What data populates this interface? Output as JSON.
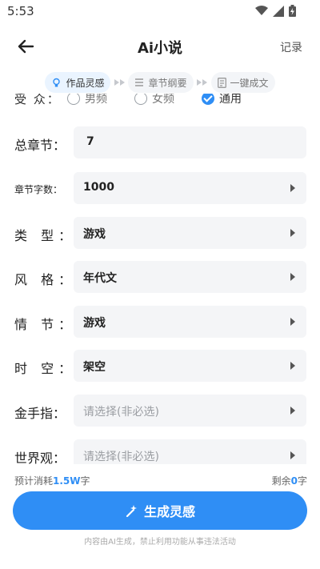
{
  "status": {
    "time": "5:53"
  },
  "header": {
    "title": "Ai小说",
    "record": "记录"
  },
  "steps": [
    {
      "label": "作品灵感",
      "active": true
    },
    {
      "label": "章节纲要",
      "active": false
    },
    {
      "label": "一键成文",
      "active": false
    }
  ],
  "form": {
    "audience": {
      "label": "受 众：",
      "options": [
        "男频",
        "女频",
        "通用"
      ],
      "selected": "通用"
    },
    "fields": [
      {
        "label": "总章节：",
        "value": "7",
        "placeholder": "",
        "dropdown": false
      },
      {
        "label": "章节字数：",
        "value": "1000",
        "placeholder": "",
        "dropdown": true
      },
      {
        "label": "类 型：",
        "value": "游戏",
        "placeholder": "",
        "dropdown": true
      },
      {
        "label": "风 格：",
        "value": "年代文",
        "placeholder": "",
        "dropdown": true
      },
      {
        "label": "情 节：",
        "value": "游戏",
        "placeholder": "",
        "dropdown": true
      },
      {
        "label": "时 空：",
        "value": "架空",
        "placeholder": "",
        "dropdown": true
      },
      {
        "label": "金手指：",
        "value": "",
        "placeholder": "请选择(非必选)",
        "dropdown": true
      },
      {
        "label": "世界观：",
        "value": "",
        "placeholder": "请选择(非必选)",
        "dropdown": true
      }
    ]
  },
  "cost": {
    "prefix": "预计消耗",
    "value": "1.5W",
    "suffix": "字"
  },
  "remaining": {
    "prefix": "剩余",
    "value": "0",
    "suffix": "字"
  },
  "generate_button": {
    "label": "生成灵感"
  },
  "footer": "内容由AI生成，禁止利用功能从事违法活动",
  "colors": {
    "accent": "#2f8ef5",
    "field_bg": "#f4f5f7"
  }
}
